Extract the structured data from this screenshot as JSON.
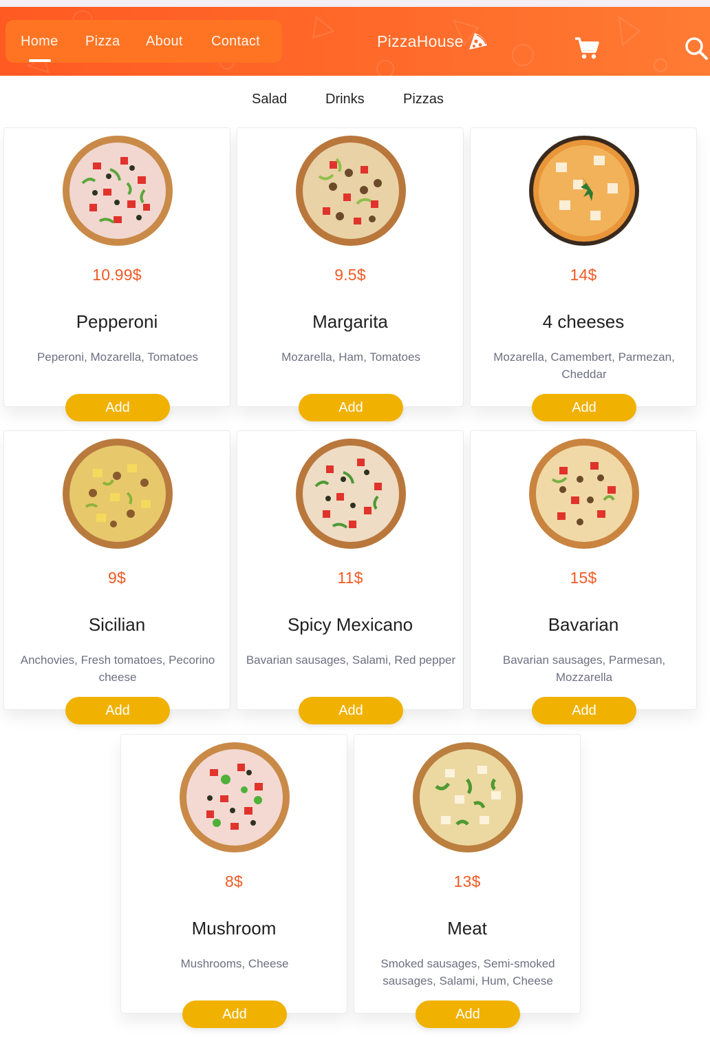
{
  "header": {
    "nav": [
      {
        "label": "Home"
      },
      {
        "label": "Pizza"
      },
      {
        "label": "About"
      },
      {
        "label": "Contact"
      }
    ],
    "brand": "PizzaHouse",
    "brand_icon": "pizza-slice-icon",
    "cart_icon": "cart-icon",
    "search_icon": "search-icon",
    "colors": {
      "header": "#ff6426",
      "accent": "#f15a24",
      "button": "#f0b100"
    }
  },
  "categories": [
    {
      "label": "Salad"
    },
    {
      "label": "Drinks"
    },
    {
      "label": "Pizzas"
    }
  ],
  "products": [
    {
      "price": "10.99$",
      "name": "Pepperoni",
      "desc": "Peperoni, Mozarella, Tomatoes",
      "button": "Add",
      "image": "pepperoni-pizza-image"
    },
    {
      "price": "9.5$",
      "name": "Margarita",
      "desc": "Mozarella, Ham, Tomatoes",
      "button": "Add",
      "image": "margarita-pizza-image"
    },
    {
      "price": "14$",
      "name": "4 cheeses",
      "desc": "Mozarella, Camembert, Parmezan, Cheddar",
      "button": "Add",
      "image": "four-cheeses-pizza-image"
    },
    {
      "price": "9$",
      "name": "Sicilian",
      "desc": "Anchovies, Fresh tomatoes, Pecorino cheese",
      "button": "Add",
      "image": "sicilian-pizza-image"
    },
    {
      "price": "11$",
      "name": "Spicy Mexicano",
      "desc": "Bavarian sausages, Salami, Red pepper",
      "button": "Add",
      "image": "spicy-mexicano-pizza-image"
    },
    {
      "price": "15$",
      "name": "Bavarian",
      "desc": "Bavarian sausages, Parmesan, Mozzarella",
      "button": "Add",
      "image": "bavarian-pizza-image"
    },
    {
      "price": "8$",
      "name": "Mushroom",
      "desc": "Mushrooms, Cheese",
      "button": "Add",
      "image": "mushroom-pizza-image"
    },
    {
      "price": "13$",
      "name": "Meat",
      "desc": "Smoked sausages, Semi-smoked sausages, Salami, Hum, Cheese",
      "button": "Add",
      "image": "meat-pizza-image"
    }
  ]
}
